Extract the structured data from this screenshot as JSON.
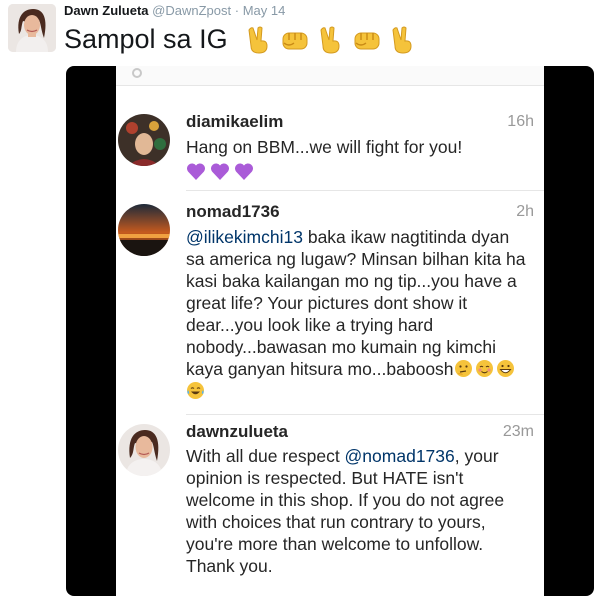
{
  "tweet": {
    "display_name": "Dawn Zulueta",
    "handle": "@DawnZpost",
    "separator": "·",
    "date": "May 14",
    "text": "Sampol sa IG",
    "emoji": [
      "victory-hand",
      "fist",
      "victory-hand",
      "fist",
      "victory-hand"
    ]
  },
  "screenshot": {
    "comments": [
      {
        "username": "diamikaelim",
        "time": "16h",
        "text": "Hang on BBM...we will fight for you!",
        "emoji": [
          "purple-heart",
          "purple-heart",
          "purple-heart"
        ]
      },
      {
        "username": "nomad1736",
        "time": "2h",
        "mention": "@ilikekimchi13",
        "text": " baka ikaw nagtitinda dyan sa america ng lugaw? Minsan bilhan kita ha kasi baka kailangan mo ng tip...you have a great life? Your pictures dont show it dear...you look like a trying hard nobody...bawasan mo kumain ng kimchi kaya ganyan hitsura mo...baboosh",
        "emoji": [
          "thinking-face",
          "blush-face",
          "grin-face",
          "tears-of-joy-face"
        ]
      },
      {
        "username": "dawnzulueta",
        "time": "23m",
        "text_before": "With all due respect ",
        "mention": "@nomad1736",
        "text_after": ", your opinion is respected. But HATE isn't welcome in this shop. If you do not agree with choices that run contrary to yours, you're more than welcome to unfollow. Thank you."
      }
    ]
  },
  "colors": {
    "name": "#14171a",
    "muted": "#8899a6",
    "mention": "#003569",
    "emoji_yellow": "#f5c33b",
    "heart_purple": "#aa5bd8"
  }
}
